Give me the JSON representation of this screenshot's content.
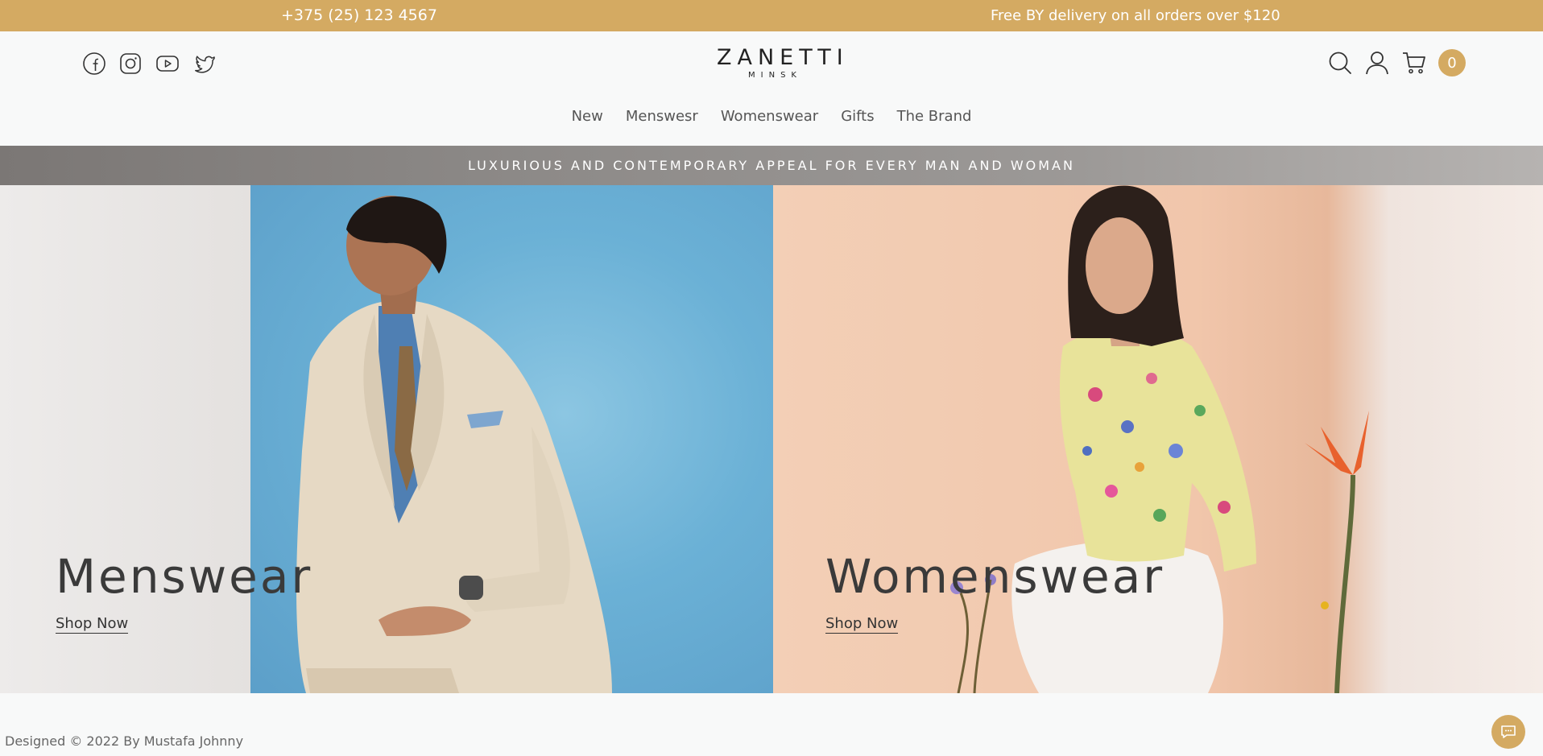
{
  "topbar": {
    "phone": "+375 (25) 123 4567",
    "promo": "Free BY delivery on all orders over $120"
  },
  "header": {
    "logo_main": "ZANETTI",
    "logo_sub": "MINSK",
    "social_icons": [
      "facebook-icon",
      "instagram-icon",
      "youtube-icon",
      "twitter-icon"
    ],
    "action_icons": [
      "search-icon",
      "user-icon",
      "cart-icon"
    ],
    "cart_count": "0"
  },
  "nav": {
    "items": [
      "New",
      "Menswesr",
      "Womenswear",
      "Gifts",
      "The Brand"
    ]
  },
  "band": {
    "text": "LUXURIOUS AND CONTEMPORARY APPEAL FOR EVERY MAN AND WOMAN"
  },
  "hero": {
    "men": {
      "title": "Menswear",
      "cta": "Shop Now"
    },
    "women": {
      "title": "Womenswear",
      "cta": "Shop Now"
    }
  },
  "footer": {
    "credit": "Designed © 2022 By Mustafa Johnny"
  },
  "colors": {
    "accent": "#d4aa62",
    "text": "#333333",
    "background": "#f8f9f9"
  }
}
